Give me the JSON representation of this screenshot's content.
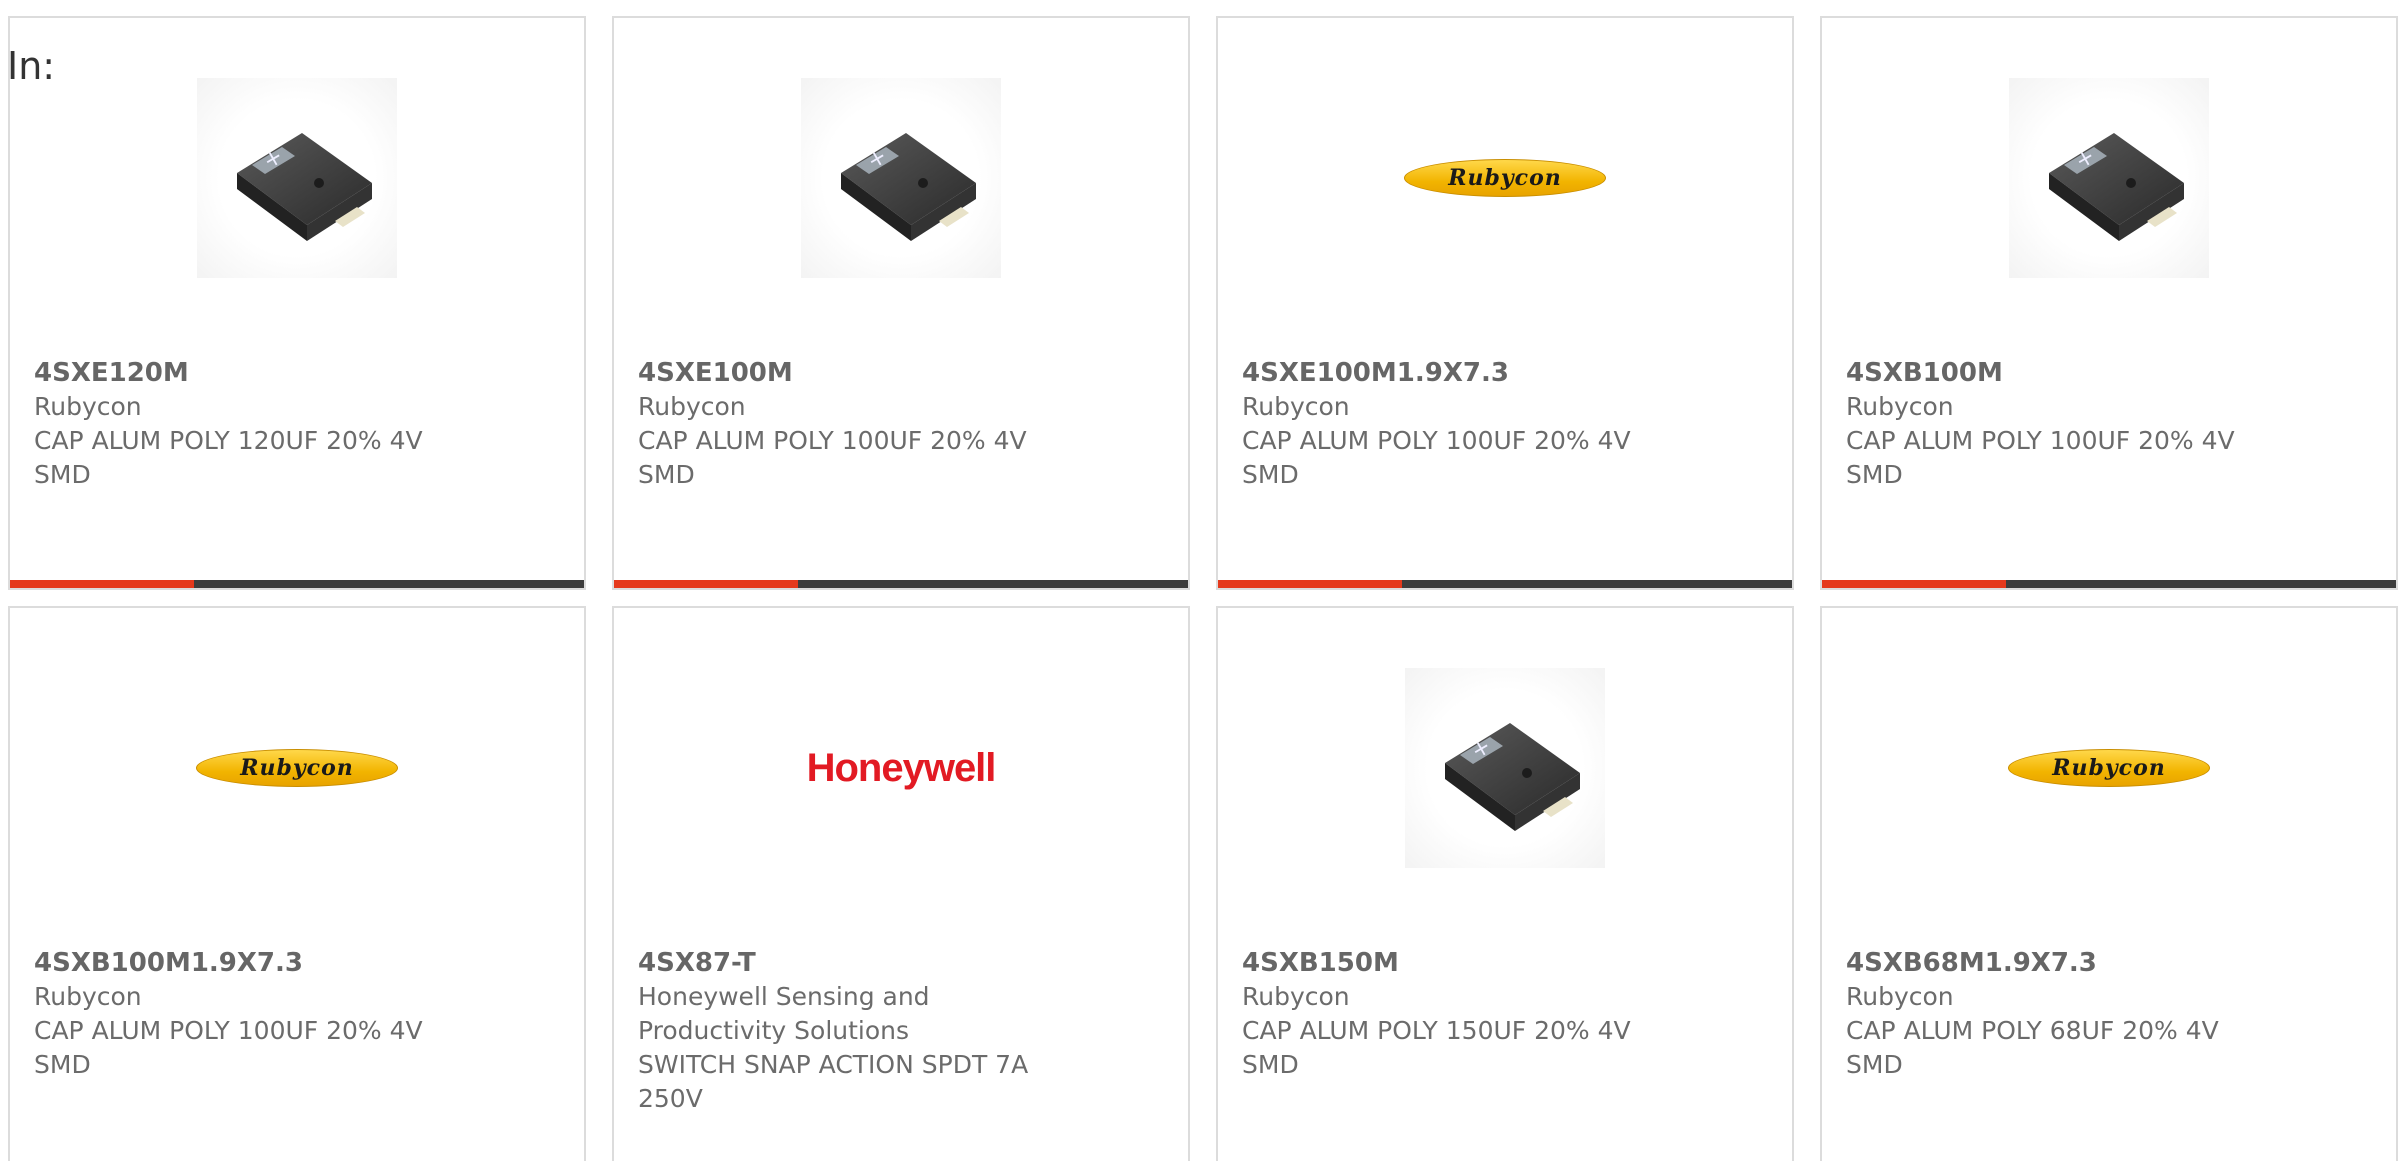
{
  "header": {
    "in_label": "In:"
  },
  "products": [
    {
      "part": "4SXE120M",
      "manufacturer": "Rubycon",
      "description": "CAP ALUM POLY 120UF 20% 4V SMD",
      "image": "capacitor"
    },
    {
      "part": "4SXE100M",
      "manufacturer": "Rubycon",
      "description": "CAP ALUM POLY 100UF 20% 4V SMD",
      "image": "capacitor"
    },
    {
      "part": "4SXE100M1.9X7.3",
      "manufacturer": "Rubycon",
      "description": "CAP ALUM POLY 100UF 20% 4V SMD",
      "image": "rubycon-logo"
    },
    {
      "part": "4SXB100M",
      "manufacturer": "Rubycon",
      "description": "CAP ALUM POLY 100UF 20% 4V SMD",
      "image": "capacitor"
    },
    {
      "part": "4SXB100M1.9X7.3",
      "manufacturer": "Rubycon",
      "description": "CAP ALUM POLY 100UF 20% 4V SMD",
      "image": "rubycon-logo"
    },
    {
      "part": "4SX87-T",
      "manufacturer": "Honeywell Sensing and Productivity Solutions",
      "description": "SWITCH SNAP ACTION SPDT 7A 250V",
      "image": "honeywell-logo"
    },
    {
      "part": "4SXB150M",
      "manufacturer": "Rubycon",
      "description": "CAP ALUM POLY 150UF 20% 4V SMD",
      "image": "capacitor"
    },
    {
      "part": "4SXB68M1.9X7.3",
      "manufacturer": "Rubycon",
      "description": "CAP ALUM POLY 68UF 20% 4V SMD",
      "image": "rubycon-logo"
    }
  ],
  "logos": {
    "rubycon": "Rubycon",
    "honeywell": "Honeywell"
  },
  "colors": {
    "accent": "#e5391c",
    "bar_dark": "#3d3d3d",
    "card_border": "#dcdcdc",
    "text": "#6b6b6b"
  }
}
